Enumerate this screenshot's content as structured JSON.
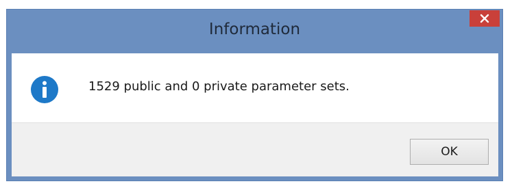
{
  "window": {
    "title": "Information",
    "close_icon": "close-icon"
  },
  "message": {
    "icon": "info-icon",
    "text": "1529 public and 0 private parameter sets."
  },
  "buttons": {
    "ok_label": "OK"
  },
  "colors": {
    "titlebar": "#6b8fc0",
    "close_button": "#c9403a",
    "info_icon": "#1e79c8"
  }
}
